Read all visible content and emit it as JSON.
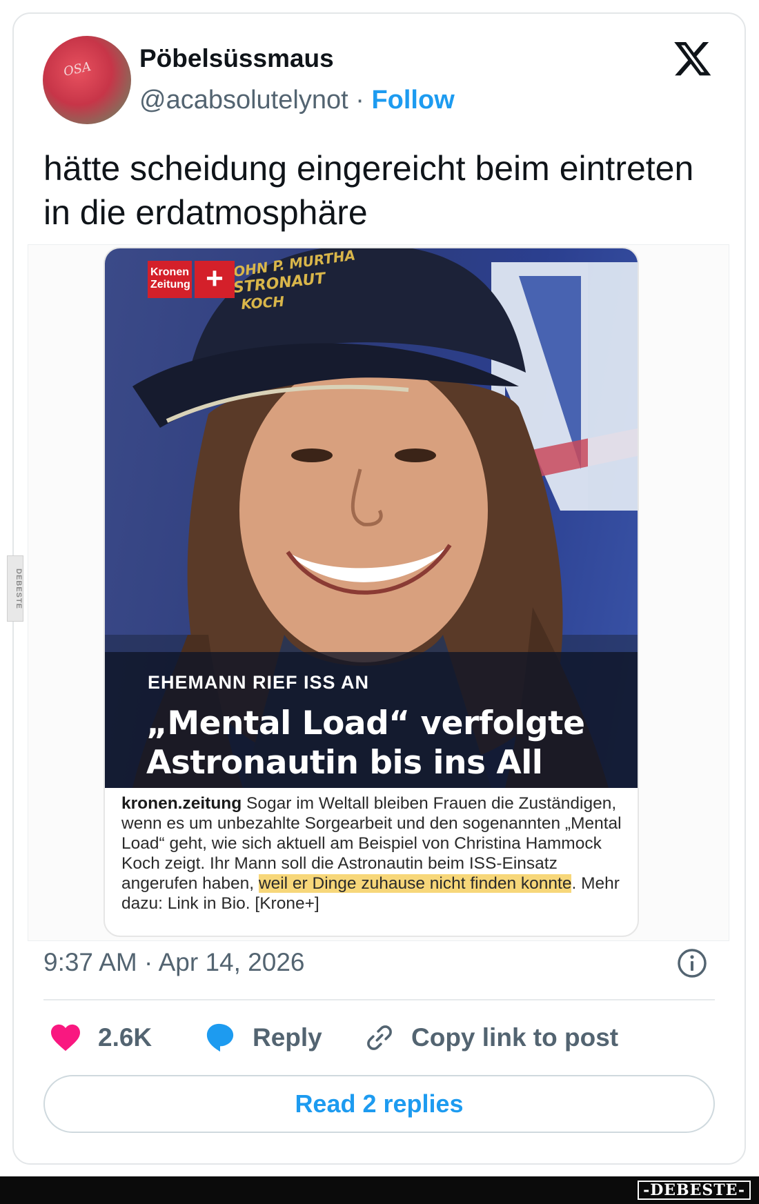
{
  "author": {
    "display_name": "Pöbelsüssmaus",
    "handle": "@acabsolutelynot",
    "separator": " · ",
    "follow_label": "Follow",
    "avatar_cap_text": "OSA"
  },
  "platform_icon": "x-logo-icon",
  "tweet": {
    "text": "hätte scheidung eingereicht beim eintreten in die erdatmosphäre"
  },
  "embedded_article": {
    "brand_name_line1": "Kronen",
    "brand_name_line2": "Zeitung",
    "brand_plus": "+",
    "cap_text_line1": "JOHN P. MURTHA",
    "cap_text_line2": "ASTRONAUT",
    "cap_text_line3": "KOCH",
    "kicker": "EHEMANN RIEF ISS AN",
    "headline": "„Mental Load“ verfolgte Astronautin bis ins All",
    "caption_source": "kronen.zeitung",
    "caption_before": " Sogar im Weltall bleiben Frauen die Zuständigen, wenn es um unbezahlte Sorgearbeit und den sogenannten „Mental Load“ geht, wie sich aktuell am Beispiel von Christina Hammock Koch zeigt. Ihr Mann soll die Astronautin beim ISS-Einsatz angerufen haben, ",
    "caption_highlight": "weil er Dinge zuhause nicht finden konnte",
    "caption_after": ". Mehr dazu: Link in Bio. [Krone+]",
    "highlight_color": "#f7d77a"
  },
  "timestamp": "9:37 AM · Apr 14, 2026",
  "actions": {
    "likes_count": "2.6K",
    "reply_label": "Reply",
    "copy_link_label": "Copy link to post"
  },
  "read_replies_label": "Read 2 replies",
  "watermarks": {
    "side": "DEBESTE",
    "bottom": "-DEBESTE-"
  },
  "colors": {
    "accent": "#1d9bf0",
    "like": "#f91880",
    "text_primary": "#0f1419",
    "text_secondary": "#536471",
    "brand_red": "#d4202a"
  }
}
